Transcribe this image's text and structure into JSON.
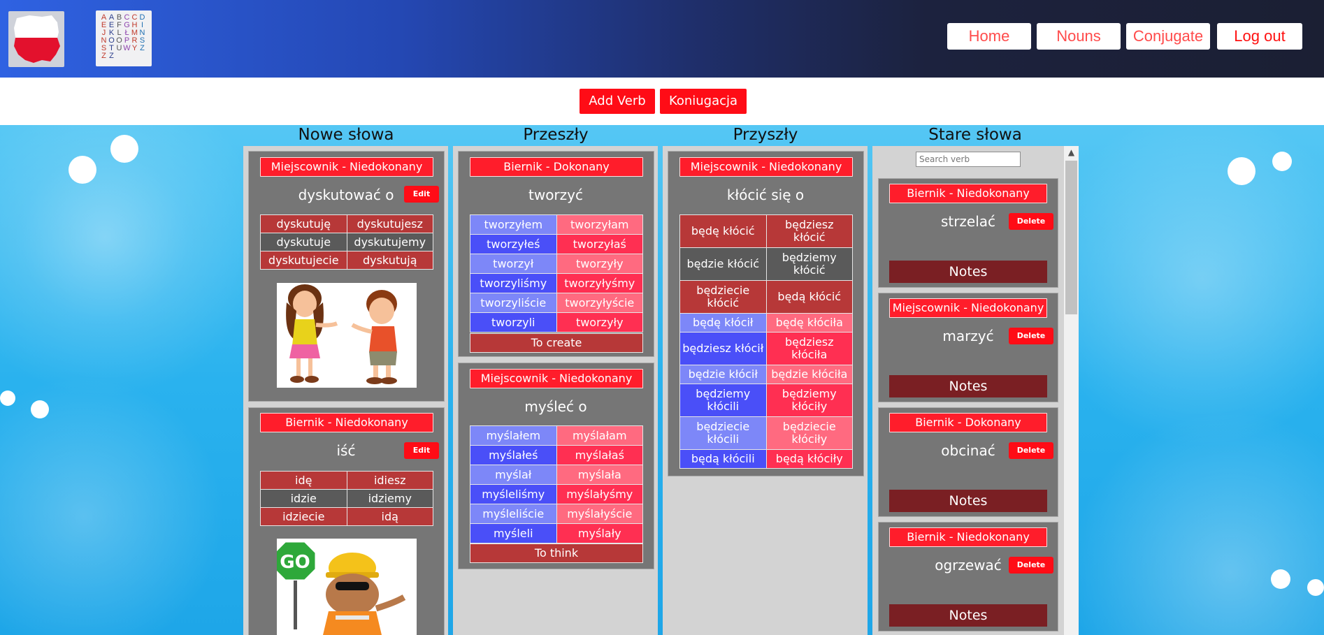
{
  "nav": {
    "home": "Home",
    "nouns": "Nouns",
    "conjugate": "Conjugate",
    "logout": "Log out"
  },
  "logo_letters": [
    "A",
    "A",
    "B",
    "C",
    "C",
    "D",
    "E",
    "E",
    "F",
    "G",
    "H",
    "I",
    "J",
    "K",
    "L",
    "Ł",
    "M",
    "N",
    "N",
    "O",
    "O",
    "P",
    "R",
    "S",
    "S",
    "T",
    "U",
    "W",
    "Y",
    "Z",
    "Z",
    "Z"
  ],
  "actions": {
    "add_verb": "Add Verb",
    "koniugacja": "Koniugacja"
  },
  "columns": {
    "new": "Nowe słowa",
    "past": "Przeszły",
    "future": "Przyszły",
    "old": "Stare słowa"
  },
  "edit_label": "Edit",
  "delete_label": "Delete",
  "notes_label": "Notes",
  "search": {
    "placeholder": "Search verb"
  },
  "new_words": [
    {
      "badge": "Miejscownik - Niedokonany",
      "verb": "dyskutować o",
      "rows": [
        [
          "dyskutuję",
          "dyskutujesz"
        ],
        [
          "dyskutuje",
          "dyskutujemy"
        ],
        [
          "dyskutujecie",
          "dyskutują"
        ]
      ]
    },
    {
      "badge": "Biernik - Niedokonany",
      "verb": "iść",
      "rows": [
        [
          "idę",
          "idiesz"
        ],
        [
          "idzie",
          "idziemy"
        ],
        [
          "idziecie",
          "idą"
        ]
      ]
    }
  ],
  "past": [
    {
      "badge": "Biernik - Dokonany",
      "verb": "tworzyć",
      "rows": [
        [
          "tworzyłem",
          "tworzyłam"
        ],
        [
          "tworzyłeś",
          "tworzyłaś"
        ],
        [
          "tworzył",
          "tworzyły"
        ],
        [
          "tworzyliśmy",
          "tworzyłyśmy"
        ],
        [
          "tworzyliście",
          "tworzyłyście"
        ],
        [
          "tworzyli",
          "tworzyły"
        ]
      ],
      "translation": "To create"
    },
    {
      "badge": "Miejscownik - Niedokonany",
      "verb": "myśleć o",
      "rows": [
        [
          "myślałem",
          "myślałam"
        ],
        [
          "myślałeś",
          "myślałaś"
        ],
        [
          "myślał",
          "myślała"
        ],
        [
          "myśleliśmy",
          "myślałyśmy"
        ],
        [
          "myśleliście",
          "myślałyście"
        ],
        [
          "myśleli",
          "myślały"
        ]
      ],
      "translation": "To think"
    }
  ],
  "future": {
    "badge": "Miejscownik - Niedokonany",
    "verb": "kłócić się o",
    "rows": [
      [
        "będę kłócić",
        "będziesz kłócić"
      ],
      [
        "będzie kłócić",
        "będziemy kłócić"
      ],
      [
        "będziecie kłócić",
        "będą kłócić"
      ],
      [
        "będę kłócił",
        "będę kłóciła"
      ],
      [
        "będziesz kłócił",
        "będziesz kłóciła"
      ],
      [
        "będzie kłócił",
        "będzie kłóciła"
      ],
      [
        "będziemy kłócili",
        "będziemy kłóciły"
      ],
      [
        "będziecie kłócili",
        "będziecie kłóciły"
      ],
      [
        "będą kłócili",
        "będą kłóciły"
      ]
    ]
  },
  "old_words": [
    {
      "badge": "Biernik - Niedokonany",
      "verb": "strzelać"
    },
    {
      "badge": "Miejscownik - Niedokonany",
      "verb": "marzyć"
    },
    {
      "badge": "Biernik - Dokonany",
      "verb": "obcinać"
    },
    {
      "badge": "Biernik - Niedokonany",
      "verb": "ogrzewać"
    }
  ],
  "icons": {
    "scroll_up": "▲"
  },
  "colors": {
    "accent_red": "#ff0c16",
    "present_red": "#b73838",
    "present_gray": "#5a5a5a",
    "masc_blue_1": "#7d87f8",
    "masc_blue_2": "#4a4ff8",
    "fem_pink_1": "#ff6a80",
    "fem_pink_2": "#ff2f52",
    "notes_dark": "#7a1f23"
  }
}
